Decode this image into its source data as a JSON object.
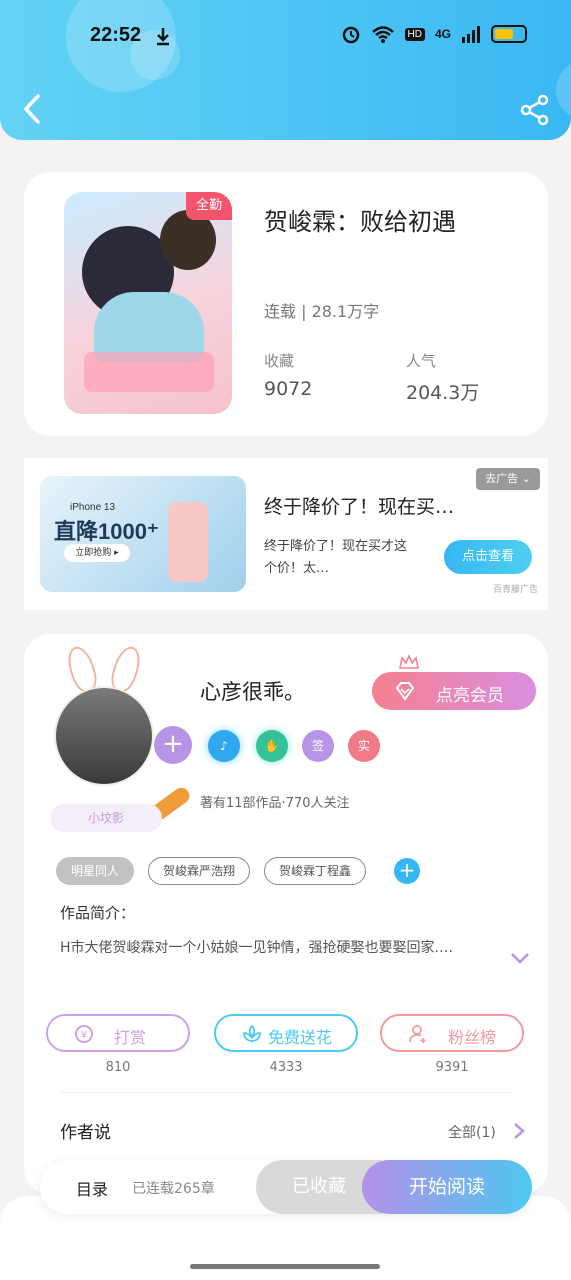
{
  "status_bar": {
    "time": "22:52",
    "net_label": "HD",
    "signal_label": "4G"
  },
  "book": {
    "cover_badge": "全勤",
    "title": "贺峻霖：败给初遇",
    "status": "连载 | 28.1万字",
    "favorites_label": "收藏",
    "favorites_value": "9072",
    "popularity_label": "人气",
    "popularity_value": "204.3万"
  },
  "ad": {
    "image_line1": "iPhone 13",
    "image_line2": "直降1000⁺",
    "image_button": "立即抢购 ▸",
    "remove_label": "去广告 ⌄",
    "title": "终于降价了！现在买…",
    "description": "终于降价了！现在买才这个价！太…",
    "cta": "点击查看",
    "source": "百青藤广告"
  },
  "author": {
    "avatar_tag": "小坟影",
    "name": "心彦很乖。",
    "vip_label": "点亮会员",
    "badges": [
      {
        "icon": "music-note-icon",
        "color": "#2fa8f0"
      },
      {
        "icon": "handshake-icon",
        "color": "#35c29a"
      },
      {
        "label": "签",
        "color": "#b894e6"
      },
      {
        "label": "实",
        "color": "#f27a86"
      }
    ],
    "stats": "著有11部作品·770人关注"
  },
  "tags": [
    "明星同人",
    "贺峻霖严浩翔",
    "贺峻霖丁程鑫"
  ],
  "intro": {
    "heading": "作品简介：",
    "text": "H市大佬贺峻霖对一个小姑娘一见钟情，强抢硬娶也要娶回家.…"
  },
  "actions": [
    {
      "label": "打赏",
      "count": "810",
      "color": "#c9a2e8",
      "icon": "yen-coin-icon"
    },
    {
      "label": "免费送花",
      "count": "4333",
      "color": "#4ccbf2",
      "icon": "flower-icon"
    },
    {
      "label": "粉丝榜",
      "count": "9391",
      "color": "#f39aa0",
      "icon": "fan-user-icon"
    }
  ],
  "author_says": {
    "heading": "作者说",
    "all_link": "全部(1)"
  },
  "bottom_bar": {
    "toc_label": "目录",
    "toc_count": "已连载265章",
    "collected": "已收藏",
    "read": "开始阅读"
  },
  "colors": {
    "header_gradient_start": "#63d3f5",
    "header_gradient_end": "#3ab8f3",
    "accent_blue": "#36b7f3",
    "vip_pink": "#f5818f",
    "purple": "#b894e6"
  }
}
